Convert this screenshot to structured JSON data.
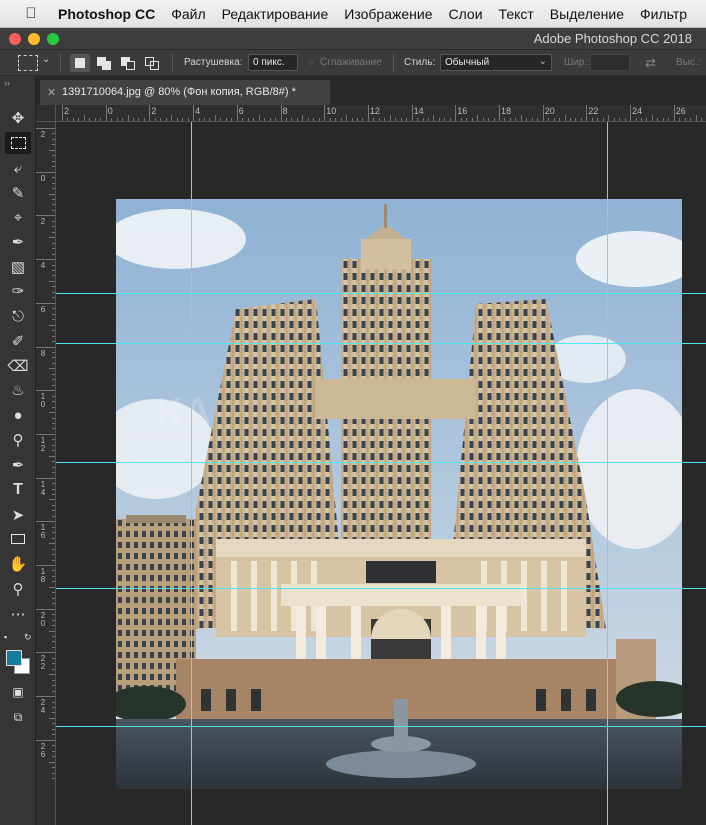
{
  "menubar": {
    "app": "Photoshop CC",
    "items": [
      "Файл",
      "Редактирование",
      "Изображение",
      "Слои",
      "Текст",
      "Выделение",
      "Фильтр"
    ]
  },
  "window": {
    "title": "Adobe Photoshop CC 2018"
  },
  "options": {
    "feather_label": "Растушевка:",
    "feather_value": "0 пикс.",
    "antialias_label": "Сглаживание",
    "style_label": "Стиль:",
    "style_value": "Обычный",
    "width_label": "Шир.:",
    "height_label": "Выс.:"
  },
  "document": {
    "tab_title": "1391710064.jpg @ 80% (Фон копия, RGB/8#) *"
  },
  "rulers": {
    "top": [
      "2",
      "0",
      "2",
      "4",
      "6",
      "8",
      "10",
      "12",
      "14",
      "16",
      "18",
      "20",
      "22",
      "24",
      "26"
    ],
    "left": [
      "2",
      "0",
      "2",
      "4",
      "6",
      "8",
      "1\n0",
      "1\n2",
      "1\n4",
      "1\n6",
      "1\n8",
      "2\n0",
      "2\n2",
      "2\n4",
      "2\n6"
    ]
  },
  "colors": {
    "foreground": "#147d9a",
    "background": "#ffffff",
    "guides": "#4de8ee"
  },
  "tools": [
    "move-tool-icon",
    "marquee-tool-icon",
    "lasso-tool-icon",
    "quick-select-icon",
    "crop-tool-icon",
    "eyedropper-icon",
    "healing-brush-icon",
    "brush-tool-icon",
    "clone-stamp-icon",
    "history-brush-icon",
    "eraser-icon",
    "paint-bucket-icon",
    "blur-tool-icon",
    "dodge-tool-icon",
    "pen-tool-icon",
    "type-tool-icon",
    "path-select-icon",
    "rectangle-tool-icon",
    "hand-tool-icon",
    "zoom-tool-icon",
    "more-tools-icon",
    "quick-mask-icon",
    "screen-mode-icon"
  ]
}
